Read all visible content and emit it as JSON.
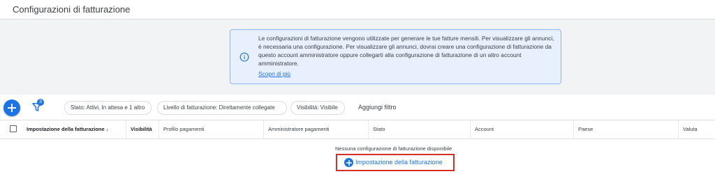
{
  "page": {
    "title": "Configurazioni di fatturazione"
  },
  "info": {
    "text": "Le configurazioni di fatturazione vengono utilizzate per generare le tue fatture mensili. Per visualizzare gli annunci, è necessaria una configurazione. Per visualizzare gli annunci, dovrai creare una configurazione di fatturazione da questo account amministratore oppure collegarti alla configurazione di fatturazione di un altro account amministratore.",
    "link": "Scopri di più"
  },
  "toolbar": {
    "filter_count": "3",
    "chips": [
      "Stato: Attivi, In attesa e 1 altro",
      "Livello di fatturazione: Direttamente collegate",
      "Visibilità: Visibile"
    ],
    "add_filter": "Aggiungi filtro"
  },
  "table": {
    "columns": [
      "Impostazione della fatturazione ↓",
      "Visibilità",
      "Profilo pagamenti",
      "Amministratore pagamenti",
      "Stato",
      "Account",
      "Paese",
      "Valuta"
    ]
  },
  "empty": {
    "message": "Nessuna configurazione di fatturazione disponibile",
    "create_label": "Impostazione della fatturazione"
  },
  "colors": {
    "accent": "#1a73e8",
    "highlight": "#d93025"
  }
}
